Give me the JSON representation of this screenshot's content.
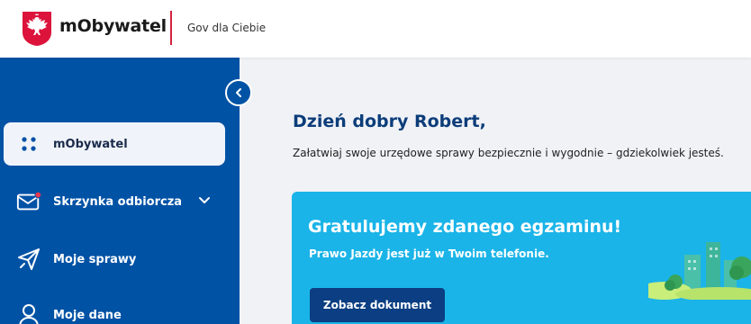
{
  "header": {
    "app_title": "mObywatel",
    "subtitle": "Gov dla Ciebie",
    "emblem_icon": "polish-eagle-emblem",
    "accent_color": "#d4213d"
  },
  "sidebar": {
    "background": "#0052a5",
    "collapse_icon": "chevron-left-icon",
    "items": [
      {
        "label": "mObywatel",
        "icon": "grid-dots-icon",
        "active": true
      },
      {
        "label": "Skrzynka odbiorcza",
        "icon": "envelope-icon",
        "has_notification": true,
        "expandable": true
      },
      {
        "label": "Moje sprawy",
        "icon": "paper-plane-icon"
      },
      {
        "label": "Moje dane",
        "icon": "user-icon"
      }
    ]
  },
  "main": {
    "greeting": "Dzień dobry Robert,",
    "subtitle": "Załatwiaj swoje urzędowe sprawy bezpiecznie i wygodnie – gdziekolwiek jesteś.",
    "banner": {
      "title": "Gratulujemy zdanego egzaminu!",
      "text": "Prawo Jazdy jest już w Twoim telefonie.",
      "button_label": "Zobacz dokument",
      "background": "#1ab4e8"
    }
  }
}
